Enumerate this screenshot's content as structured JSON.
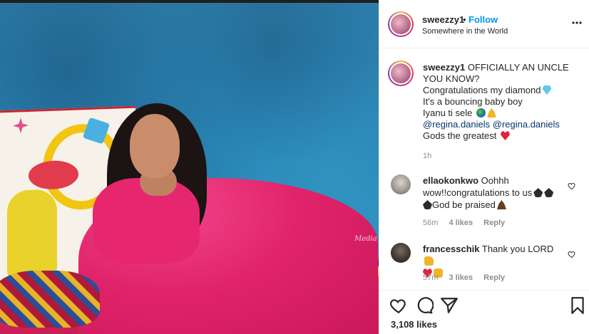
{
  "post": {
    "username": "sweezzy1",
    "dot": "•",
    "follow_label": "Follow",
    "location": "Somewhere in the World",
    "more_label": "•••"
  },
  "caption": {
    "username": "sweezzy1",
    "lines": [
      "OFFICIALLY AN UNCLE YOU KNOW?",
      "Congratulations my diamond",
      "It's a bouncing baby boy",
      "Iyanu ti sele",
      "@regina.daniels @regina.daniels",
      "Gods the greatest"
    ],
    "time": "1h"
  },
  "comments": [
    {
      "username": "ellaokonkwo",
      "text_a": "Oohhh",
      "text_b": "wow!!congratulations to us",
      "text_c": "God be praised",
      "time": "56m",
      "likes": "4 likes",
      "reply": "Reply"
    },
    {
      "username": "francesschik",
      "text_a": "Thank you LORD",
      "time": "57m",
      "likes": "3 likes",
      "reply": "Reply"
    }
  ],
  "footer": {
    "likes": "3,108 likes"
  },
  "photo": {
    "watermark": "Media"
  },
  "icons": [
    "more-icon",
    "heart-icon",
    "comment-icon",
    "share-icon",
    "bookmark-icon"
  ],
  "colors": {
    "follow": "#0095f6",
    "heart": "#e0243b",
    "muted": "#8e8e8e",
    "dress": "#e0236a",
    "backdrop": "#2a86b6"
  }
}
